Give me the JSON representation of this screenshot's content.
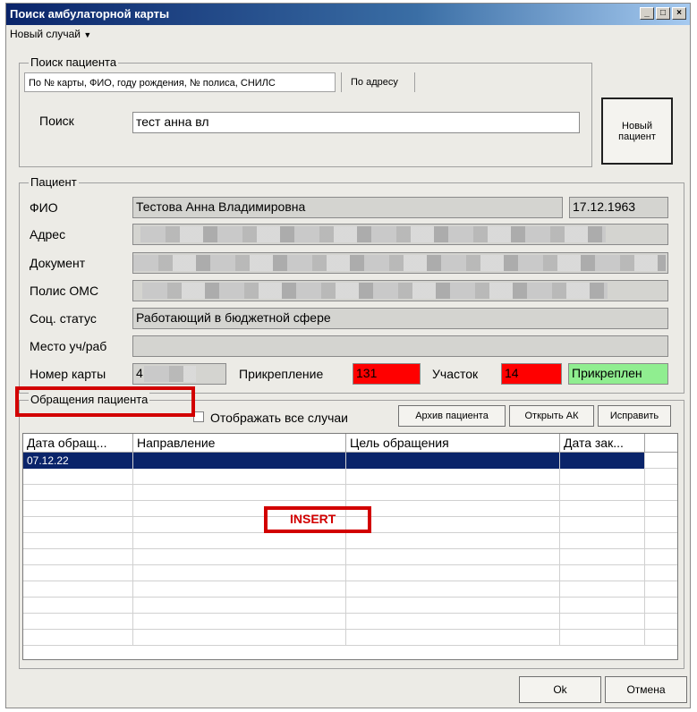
{
  "window": {
    "title": "Поиск амбулаторной карты"
  },
  "menu": {
    "new_case": "Новый случай"
  },
  "search_group": {
    "title": "Поиск пациента",
    "tabs": [
      "По № карты, ФИО, году рождения, № полиса, СНИЛС",
      "По адресу"
    ],
    "search_label": "Поиск",
    "search_value": "тест анна вл",
    "new_patient_btn": [
      "Новый",
      "пациент"
    ]
  },
  "patient_group": {
    "title": "Пациент",
    "fio_label": "ФИО",
    "fio_value": "Тестова Анна Владимировна",
    "birth_date": "17.12.1963",
    "address_label": "Адрес",
    "document_label": "Документ",
    "policy_label": "Полис ОМС",
    "social_label": "Соц. статус",
    "social_value": "Работающий в бюджетной сфере",
    "work_label": "Место уч/раб",
    "work_value": "",
    "card_label": "Номер карты",
    "card_value": "4",
    "attach_label": "Прикрепление",
    "attach_value": "131",
    "district_label": "Участок",
    "district_value": "14",
    "status_value": "Прикреплен"
  },
  "visits_group": {
    "title": "Обращения пациента",
    "show_all_label": "Отображать все случаи",
    "archive_btn": "Архив пациента",
    "open_btn": "Открыть АК",
    "fix_btn": "Исправить",
    "columns": [
      "Дата обращ...",
      "Направление",
      "Цель обращения",
      "Дата зак..."
    ],
    "rows": [
      {
        "date": "07.12.22",
        "direction": "",
        "goal": "",
        "close_date": ""
      }
    ]
  },
  "annotation": {
    "insert_label": "INSERT"
  },
  "footer": {
    "ok_btn": "Ok",
    "cancel_btn": "Отмена"
  },
  "colors": {
    "attach_bg": "#ff0000",
    "status_bg": "#90ee90",
    "selection": "#0a246a",
    "annotation": "#d20000"
  }
}
